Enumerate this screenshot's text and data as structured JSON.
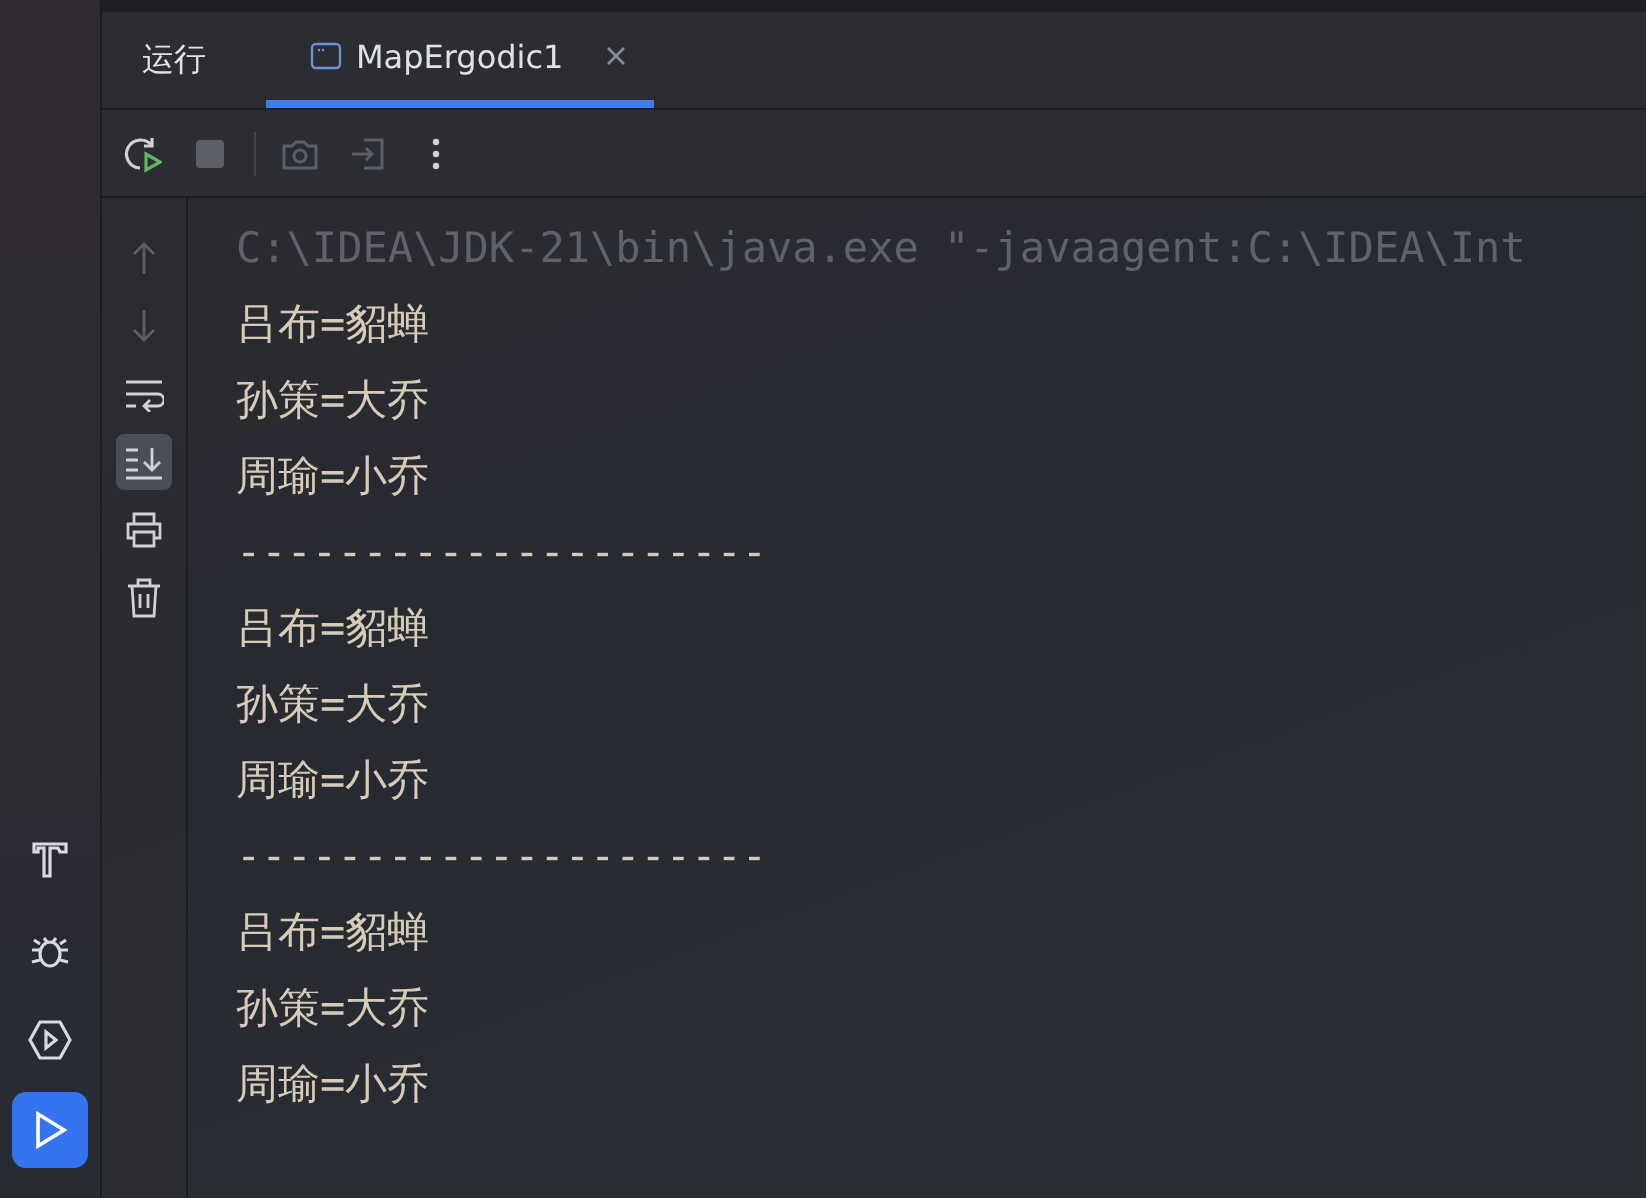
{
  "tool_window": {
    "title": "运行"
  },
  "tabs": [
    {
      "label": "MapErgodic1",
      "selected": true,
      "closable": true
    }
  ],
  "toolbar": [
    {
      "kind": "rerun",
      "disabled": false
    },
    {
      "kind": "stop",
      "disabled": true
    },
    {
      "kind": "separator"
    },
    {
      "kind": "camera",
      "disabled": true
    },
    {
      "kind": "exit",
      "disabled": true
    },
    {
      "kind": "more",
      "disabled": false
    }
  ],
  "console_actions": [
    {
      "kind": "up",
      "disabled": true,
      "selected": false
    },
    {
      "kind": "down",
      "disabled": true,
      "selected": false
    },
    {
      "kind": "wrap",
      "disabled": false,
      "selected": false
    },
    {
      "kind": "scroll-end",
      "disabled": false,
      "selected": true
    },
    {
      "kind": "print",
      "disabled": false,
      "selected": false
    },
    {
      "kind": "delete",
      "disabled": false,
      "selected": false
    }
  ],
  "left_strip": [
    {
      "kind": "build",
      "selected": false
    },
    {
      "kind": "debug",
      "selected": false
    },
    {
      "kind": "services",
      "selected": false
    },
    {
      "kind": "run",
      "selected": true
    }
  ],
  "console_lines": [
    {
      "kind": "command",
      "text": "C:\\IDEA\\JDK-21\\bin\\java.exe \"-javaagent:C:\\IDEA\\Int"
    },
    {
      "kind": "output",
      "text": "吕布=貂蝉"
    },
    {
      "kind": "output",
      "text": "孙策=大乔"
    },
    {
      "kind": "output",
      "text": "周瑜=小乔"
    },
    {
      "kind": "output",
      "text": "---------------------"
    },
    {
      "kind": "output",
      "text": "吕布=貂蝉"
    },
    {
      "kind": "output",
      "text": "孙策=大乔"
    },
    {
      "kind": "output",
      "text": "周瑜=小乔"
    },
    {
      "kind": "output",
      "text": "---------------------"
    },
    {
      "kind": "output",
      "text": "吕布=貂蝉"
    },
    {
      "kind": "output",
      "text": "孙策=大乔"
    },
    {
      "kind": "output",
      "text": "周瑜=小乔"
    }
  ]
}
